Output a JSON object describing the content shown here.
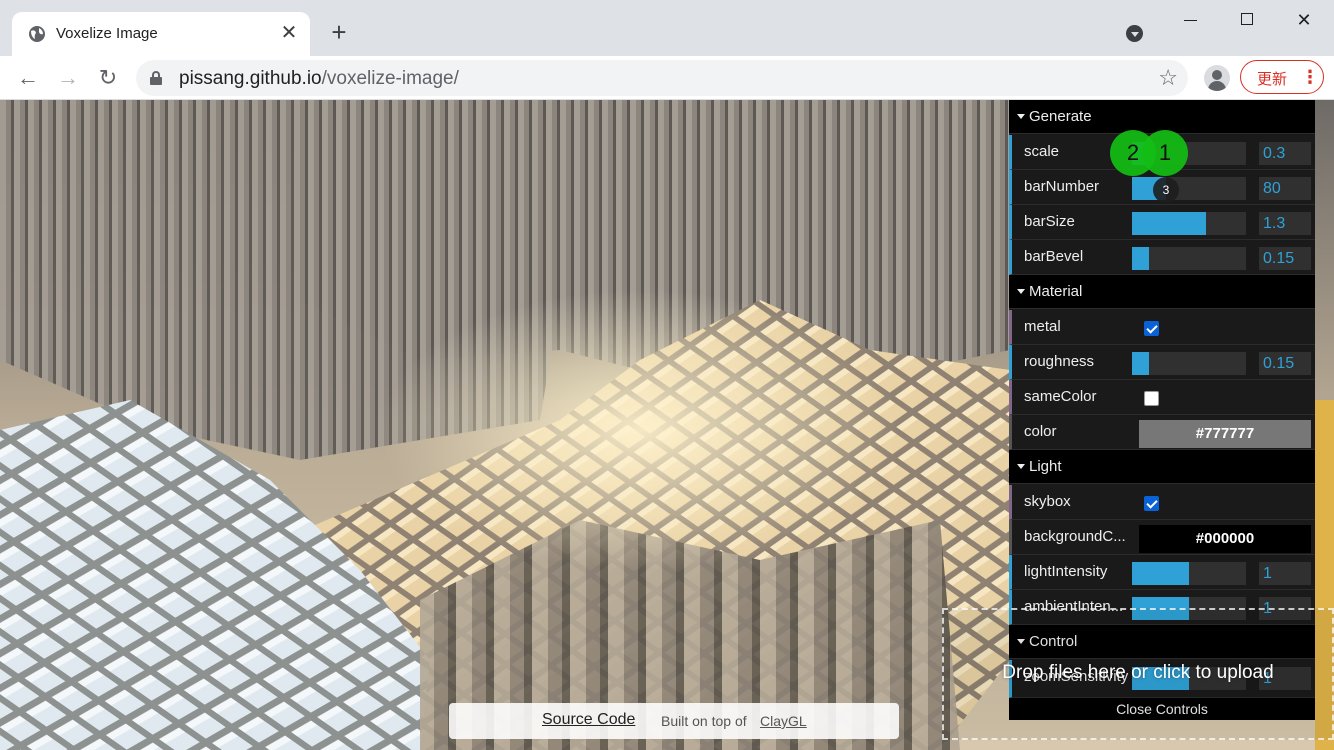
{
  "browser": {
    "tab_title": "Voxelize Image",
    "tab_close": "✕",
    "new_tab": "+",
    "url_host": "pissang.github.io",
    "url_path": "/voxelize-image/",
    "update_label": "更新",
    "update_menu": "⋮",
    "back": "←",
    "forward": "→",
    "reload": "↻",
    "bookmark": "☆",
    "close_window": "✕"
  },
  "gui": {
    "folders": {
      "generate": "Generate",
      "material": "Material",
      "light": "Light",
      "control": "Control"
    },
    "generate": {
      "scale": {
        "label": "scale",
        "value": "0.3",
        "fraction": 0.15
      },
      "barNumber": {
        "label": "barNumber",
        "value": "80",
        "fraction": 0.3
      },
      "barSize": {
        "label": "barSize",
        "value": "1.3",
        "fraction": 0.65
      },
      "barBevel": {
        "label": "barBevel",
        "value": "0.15",
        "fraction": 0.15
      }
    },
    "material": {
      "metal": {
        "label": "metal",
        "checked": true
      },
      "roughness": {
        "label": "roughness",
        "value": "0.15",
        "fraction": 0.15
      },
      "sameColor": {
        "label": "sameColor",
        "checked": false
      },
      "color": {
        "label": "color",
        "value": "#777777"
      }
    },
    "light": {
      "skybox": {
        "label": "skybox",
        "checked": true
      },
      "backgroundColor": {
        "label": "backgroundC...",
        "value": "#000000"
      },
      "lightIntensity": {
        "label": "lightIntensity",
        "value": "1",
        "fraction": 0.5
      },
      "ambientIntensity": {
        "label": "ambientInten...",
        "value": "1",
        "fraction": 0.5
      }
    },
    "control": {
      "zoomSensitivity": {
        "label": "zoomSensitivity",
        "value": "1",
        "fraction": 0.5
      }
    },
    "close_controls": "Close Controls"
  },
  "upload": {
    "text": "Drop files here or click to upload"
  },
  "footer": {
    "source_code": "Source Code",
    "built_on": "Built on top of",
    "claygl": "ClayGL"
  },
  "markers": {
    "m1": "1",
    "m2": "2",
    "m3": "3"
  }
}
